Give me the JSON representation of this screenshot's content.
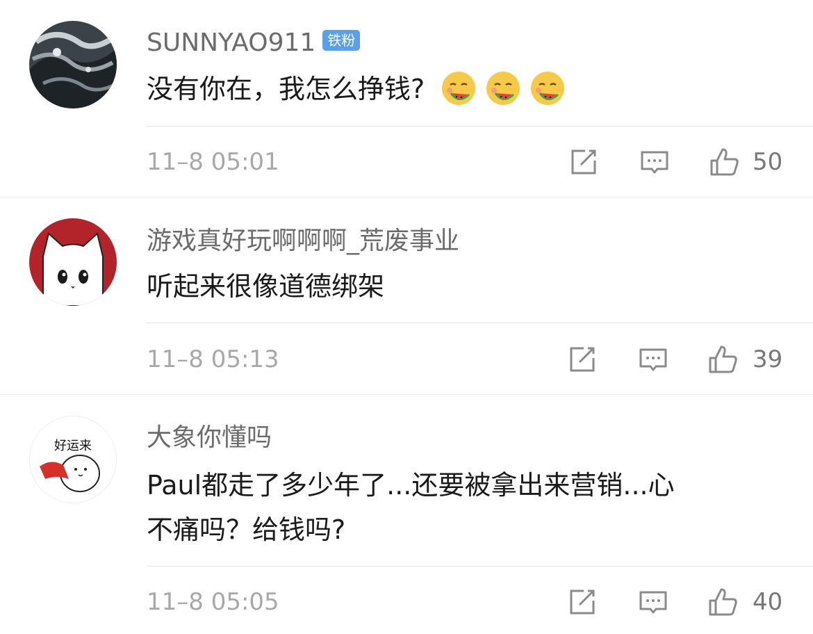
{
  "comments": [
    {
      "username": "SUNNYAO911",
      "badge": "铁粉",
      "text": "没有你在，我怎么挣钱?",
      "emoji": [
        "watermelon-emoji",
        "watermelon-emoji",
        "watermelon-emoji"
      ],
      "time": "11–8 05:01",
      "likes": "50"
    },
    {
      "username": "游戏真好玩啊啊啊_荒废事业",
      "text": "听起来很像道德绑架",
      "time": "11–8 05:13",
      "likes": "39"
    },
    {
      "username": "大象你懂吗",
      "text_line1": "Paul都走了多少年了...还要被拿出来营销...心",
      "text_line2": "不痛吗？给钱吗?",
      "avatar_text": "好运来",
      "time": "11–8 05:05",
      "likes": "40"
    }
  ],
  "colors": {
    "username": "#6b6b6b",
    "text": "#1a1a1a",
    "meta": "#a8a8a8",
    "badge": "#5aa0e8",
    "icon": "#8a8a8a",
    "avatar2_bg": "#b3242a"
  },
  "icons": [
    "repost-icon",
    "comment-icon",
    "like-icon"
  ]
}
